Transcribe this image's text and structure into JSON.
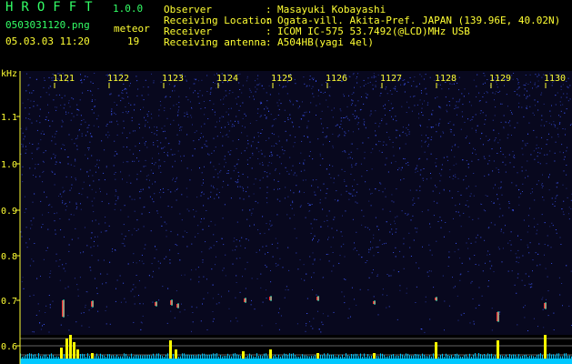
{
  "header": {
    "app_title": "HROFFT",
    "version": "1.0.0",
    "filename": "0503031120.png",
    "datetime": "05.03.03 11:20",
    "meteor_label": "meteor",
    "meteor_count": "19",
    "info": [
      {
        "label": "Observer",
        "value": "Masayuki Kobayashi"
      },
      {
        "label": "Receiving Location",
        "value": "Ogata-vill. Akita-Pref. JAPAN (139.96E, 40.02N)"
      },
      {
        "label": "Receiver",
        "value": "ICOM IC-575 53.7492(@LCD)MHz USB"
      },
      {
        "label": "Receiving antenna",
        "value": "A504HB(yagi 4el)"
      }
    ]
  },
  "spectrogram": {
    "unit_label": "kHz",
    "time_ticks": [
      "1121",
      "1122",
      "1123",
      "1124",
      "1125",
      "1126",
      "1127",
      "1128",
      "1129",
      "1130"
    ],
    "freq_ticks": [
      "1.1",
      "1.0",
      "0.9",
      "0.8",
      "0.7",
      "0.6"
    ],
    "colors": {
      "background": "#08081e",
      "noise": "#2a3cd6",
      "meteor": "#ff3030",
      "tick": "#ffff33",
      "histogram": "#ffff00",
      "baseline": "#00c8ff"
    }
  }
}
